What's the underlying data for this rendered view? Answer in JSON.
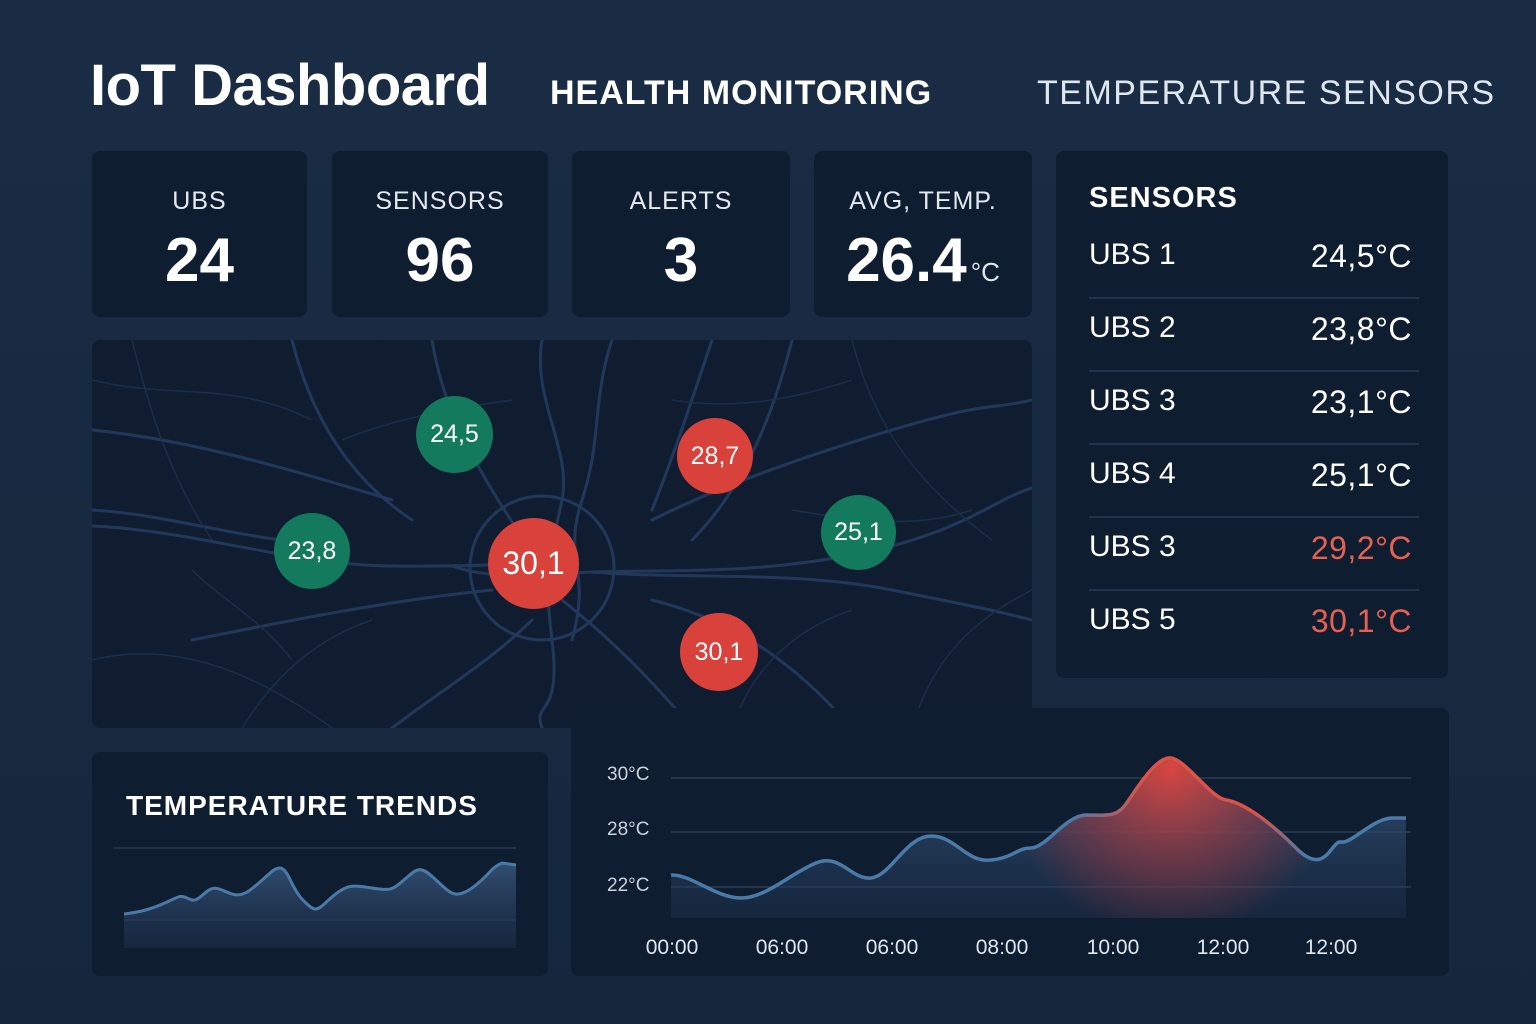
{
  "header": {
    "title": "IoT Dashboard",
    "nav": [
      "HEALTH MONITORING",
      "TEMPERATURE SENSORS"
    ]
  },
  "kpis": [
    {
      "label": "UBS",
      "value": "24"
    },
    {
      "label": "SENSORS",
      "value": "96"
    },
    {
      "label": "ALERTS",
      "value": "3"
    },
    {
      "label": "AVG, TEMP.",
      "value": "26.4",
      "unit": "°C"
    }
  ],
  "sensors": {
    "title": "SENSORS",
    "items": [
      {
        "name": "UBS 1",
        "value": "24,5°C",
        "status": "normal"
      },
      {
        "name": "UBS 2",
        "value": "23,8°C",
        "status": "normal"
      },
      {
        "name": "UBS 3",
        "value": "23,1°C",
        "status": "normal"
      },
      {
        "name": "UBS 4",
        "value": "25,1°C",
        "status": "normal"
      },
      {
        "name": "UBS 3",
        "value": "29,2°C",
        "status": "alert"
      },
      {
        "name": "UBS 5",
        "value": "30,1°C",
        "status": "alert"
      }
    ]
  },
  "map": {
    "markers": [
      {
        "value": "24,5",
        "status": "normal"
      },
      {
        "value": "28,7",
        "status": "alert"
      },
      {
        "value": "23,8",
        "status": "normal"
      },
      {
        "value": "30,1",
        "status": "alert"
      },
      {
        "value": "25,1",
        "status": "normal"
      },
      {
        "value": "30,1",
        "status": "alert"
      }
    ]
  },
  "trends": {
    "title": "TEMPERATURE TRENDS"
  },
  "colors": {
    "background": "#182940",
    "panel": "#0f1d30",
    "alert": "#d9413b",
    "alert_text": "#e86150",
    "normal": "#137a5d",
    "line": "#4a7aa8"
  },
  "chart_data": {
    "type": "area",
    "y_tick_labels": [
      "30°C",
      "28°C",
      "22°C"
    ],
    "x_tick_labels": [
      "00:00",
      "06:00",
      "06:00",
      "08:00",
      "10:00",
      "12:00",
      "12:00"
    ],
    "highlight": "red shading around the peak near 11:00"
  }
}
